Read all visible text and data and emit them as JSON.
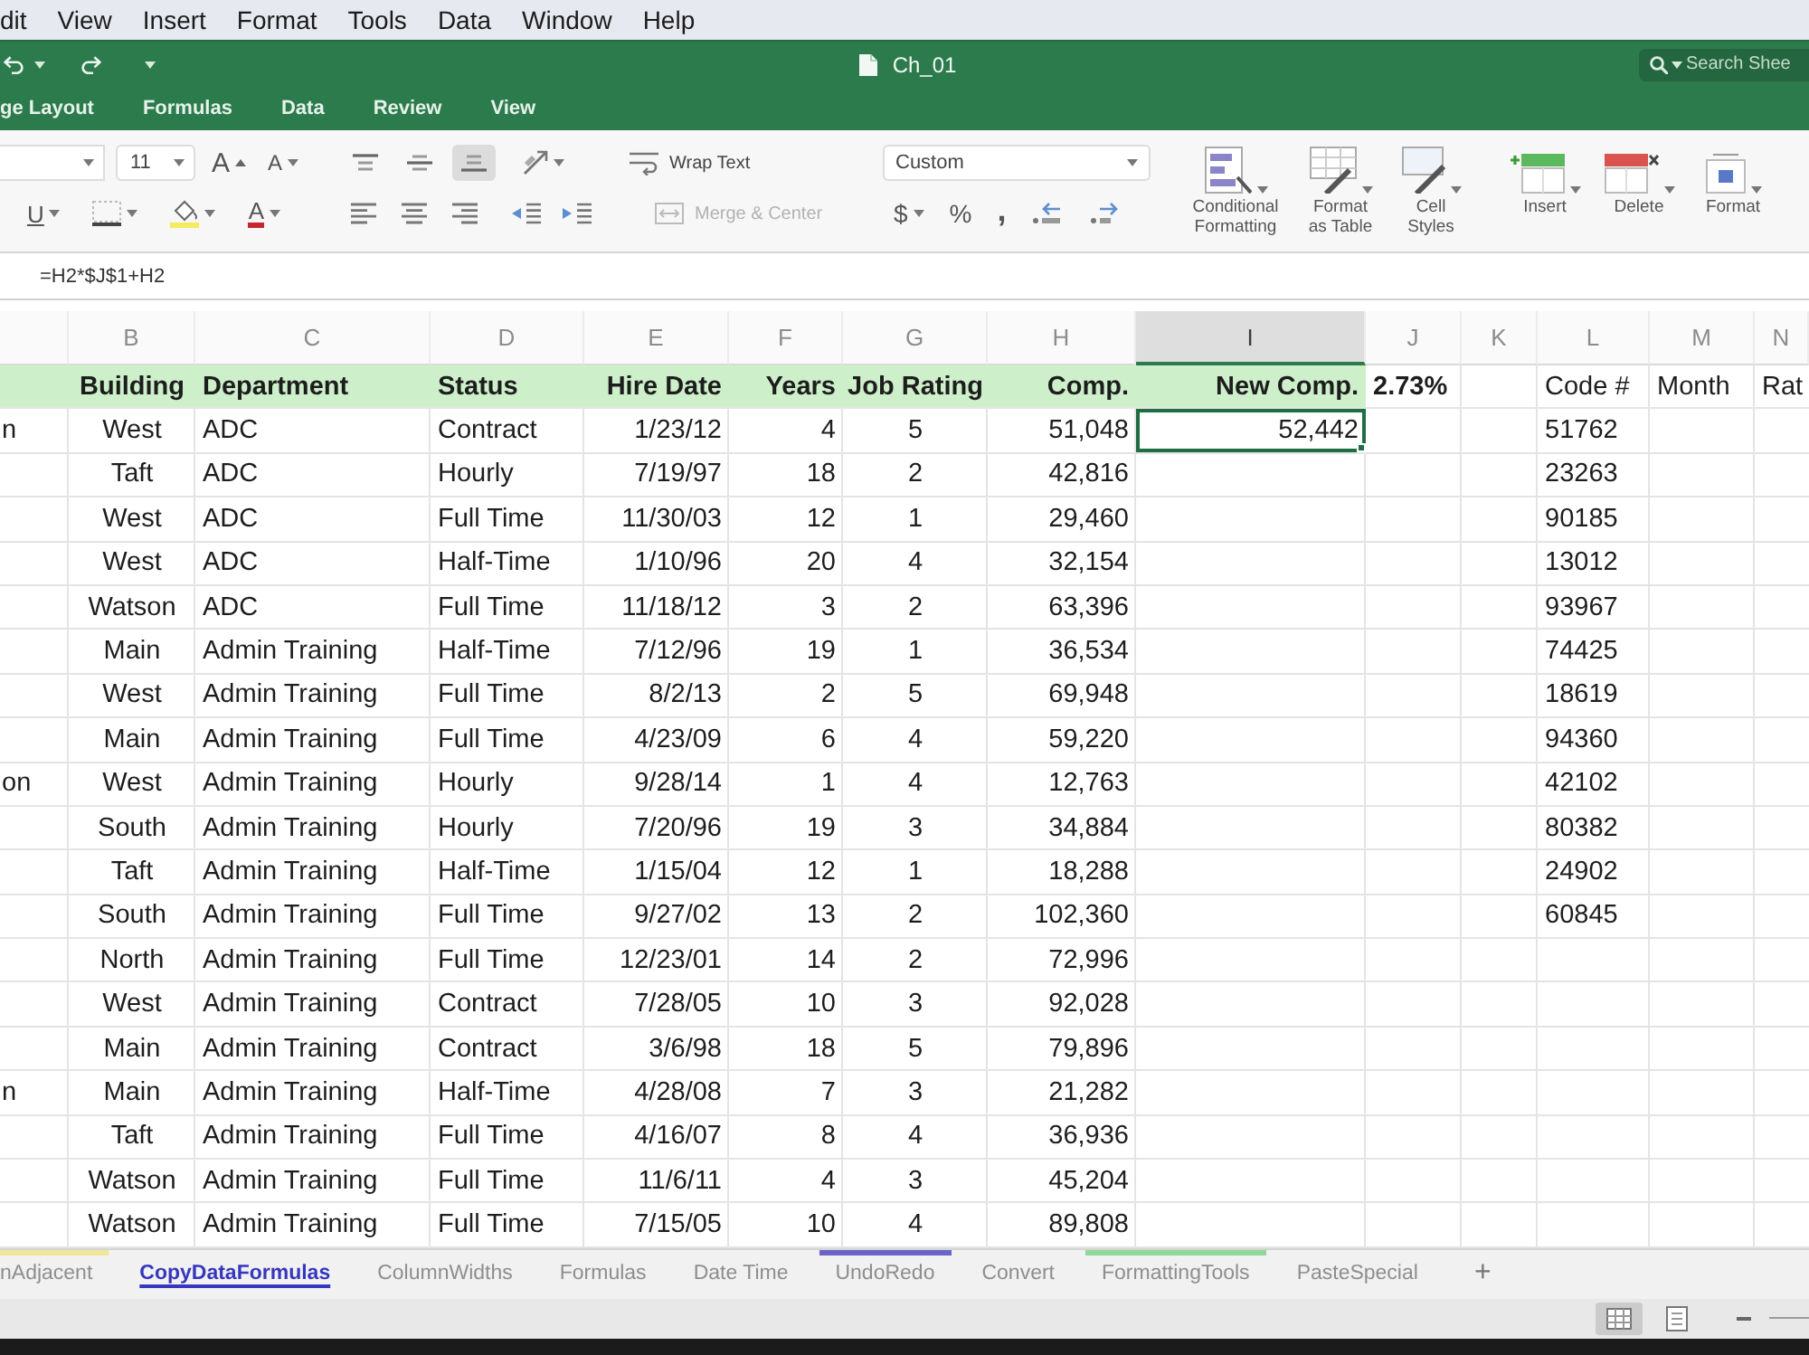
{
  "menu_bar": [
    "dit",
    "View",
    "Insert",
    "Format",
    "Tools",
    "Data",
    "Window",
    "Help"
  ],
  "title_bar": {
    "title": "Ch_01",
    "search": {
      "placeholder": "Search Shee"
    }
  },
  "ribbon_tabs": [
    {
      "label": "ge Layout",
      "selected": false
    },
    {
      "label": "Formulas",
      "selected": false
    },
    {
      "label": "Data",
      "selected": false
    },
    {
      "label": "Review",
      "selected": false
    },
    {
      "label": "View",
      "selected": false
    }
  ],
  "ribbon": {
    "font_size": "11",
    "font_buttons": [
      {
        "glyph": "A",
        "kind": "grow"
      },
      {
        "glyph": "A",
        "kind": "shrink"
      }
    ],
    "underline": "U",
    "font_color": "A",
    "vertical_align": [
      {
        "kind": "top",
        "selected": false
      },
      {
        "kind": "middle",
        "selected": false
      },
      {
        "kind": "bottom",
        "selected": true
      }
    ],
    "wrap_text": "Wrap Text",
    "merge_center": {
      "label": "Merge & Center",
      "disabled": true
    },
    "number_format": "Custom",
    "number_buttons": [
      {
        "glyph": "$",
        "kind": "currency"
      },
      {
        "glyph": "%",
        "kind": "percent"
      },
      {
        "glyph": ",",
        "kind": "comma"
      }
    ],
    "big_buttons": [
      {
        "label": "Conditional Formatting",
        "kind": "conditional"
      },
      {
        "label": "Format as Table",
        "kind": "table"
      },
      {
        "label": "Cell Styles",
        "kind": "styles"
      },
      {
        "label": "Insert",
        "kind": "insert"
      },
      {
        "label": "Delete",
        "kind": "delete"
      },
      {
        "label": "Format",
        "kind": "format"
      }
    ]
  },
  "formula_bar": {
    "formula": "=H2*$J$1+H2"
  },
  "sheet": {
    "columns": [
      {
        "selected": false
      },
      {
        "label": "B",
        "selected": false
      },
      {
        "label": "C",
        "selected": false
      },
      {
        "label": "D",
        "selected": false
      },
      {
        "label": "E",
        "selected": false
      },
      {
        "label": "F",
        "selected": false
      },
      {
        "label": "G",
        "selected": false
      },
      {
        "label": "H",
        "selected": false
      },
      {
        "label": "I",
        "selected": true
      },
      {
        "label": "J",
        "selected": false
      },
      {
        "label": "K",
        "selected": false
      },
      {
        "label": "L",
        "selected": false
      },
      {
        "label": "M",
        "selected": false
      },
      {
        "label": "N",
        "selected": false
      }
    ],
    "rows": [
      {
        "kind": "header",
        "selected": false,
        "cells": [
          {
            "kind": "table_header"
          },
          {
            "text": "Building",
            "kind": "table_header"
          },
          {
            "text": "Department",
            "kind": "table_header"
          },
          {
            "text": "Status",
            "kind": "table_header"
          },
          {
            "text": "Hire Date",
            "kind": "table_header"
          },
          {
            "text": "Years",
            "kind": "table_header"
          },
          {
            "text": "Job Rating",
            "kind": "table_header"
          },
          {
            "text": "Comp.",
            "kind": "table_header"
          },
          {
            "text": "New Comp.",
            "kind": "table_header"
          },
          {
            "text": "2.73%",
            "kind": "bold"
          },
          null,
          {
            "text": "Code #",
            "kind": "plain"
          },
          {
            "text": "Month",
            "kind": "plain"
          },
          {
            "text": "Rat",
            "kind": "plain"
          }
        ]
      },
      {
        "kind": "data",
        "selected": true,
        "cells": [
          "n",
          "West",
          "ADC",
          "Contract",
          "1/23/12",
          "4",
          "5",
          "51,048",
          "52,442",
          null,
          null,
          "51762"
        ]
      },
      {
        "kind": "data",
        "selected": false,
        "cells": [
          null,
          "Taft",
          "ADC",
          "Hourly",
          "7/19/97",
          "18",
          "2",
          "42,816",
          null,
          null,
          null,
          "23263"
        ]
      },
      {
        "kind": "data",
        "selected": false,
        "cells": [
          null,
          "West",
          "ADC",
          "Full Time",
          "11/30/03",
          "12",
          "1",
          "29,460",
          null,
          null,
          null,
          "90185"
        ]
      },
      {
        "kind": "data",
        "selected": false,
        "cells": [
          null,
          "West",
          "ADC",
          "Half-Time",
          "1/10/96",
          "20",
          "4",
          "32,154",
          null,
          null,
          null,
          "13012"
        ]
      },
      {
        "kind": "data",
        "selected": false,
        "cells": [
          null,
          "Watson",
          "ADC",
          "Full Time",
          "11/18/12",
          "3",
          "2",
          "63,396",
          null,
          null,
          null,
          "93967"
        ]
      },
      {
        "kind": "data",
        "selected": false,
        "cells": [
          null,
          "Main",
          "Admin Training",
          "Half-Time",
          "7/12/96",
          "19",
          "1",
          "36,534",
          null,
          null,
          null,
          "74425"
        ]
      },
      {
        "kind": "data",
        "selected": false,
        "cells": [
          null,
          "West",
          "Admin Training",
          "Full Time",
          "8/2/13",
          "2",
          "5",
          "69,948",
          null,
          null,
          null,
          "18619"
        ]
      },
      {
        "kind": "data",
        "selected": false,
        "cells": [
          null,
          "Main",
          "Admin Training",
          "Full Time",
          "4/23/09",
          "6",
          "4",
          "59,220",
          null,
          null,
          null,
          "94360"
        ]
      },
      {
        "kind": "data",
        "selected": false,
        "cells": [
          "on",
          "West",
          "Admin Training",
          "Hourly",
          "9/28/14",
          "1",
          "4",
          "12,763",
          null,
          null,
          null,
          "42102"
        ]
      },
      {
        "kind": "data",
        "selected": false,
        "cells": [
          null,
          "South",
          "Admin Training",
          "Hourly",
          "7/20/96",
          "19",
          "3",
          "34,884",
          null,
          null,
          null,
          "80382"
        ]
      },
      {
        "kind": "data",
        "selected": false,
        "cells": [
          null,
          "Taft",
          "Admin Training",
          "Half-Time",
          "1/15/04",
          "12",
          "1",
          "18,288",
          null,
          null,
          null,
          "24902"
        ]
      },
      {
        "kind": "data",
        "selected": false,
        "cells": [
          null,
          "South",
          "Admin Training",
          "Full Time",
          "9/27/02",
          "13",
          "2",
          "102,360",
          null,
          null,
          null,
          "60845"
        ]
      },
      {
        "kind": "data",
        "selected": false,
        "cells": [
          null,
          "North",
          "Admin Training",
          "Full Time",
          "12/23/01",
          "14",
          "2",
          "72,996"
        ]
      },
      {
        "kind": "data",
        "selected": false,
        "cells": [
          null,
          "West",
          "Admin Training",
          "Contract",
          "7/28/05",
          "10",
          "3",
          "92,028"
        ]
      },
      {
        "kind": "data",
        "selected": false,
        "cells": [
          null,
          "Main",
          "Admin Training",
          "Contract",
          "3/6/98",
          "18",
          "5",
          "79,896"
        ]
      },
      {
        "kind": "data",
        "selected": false,
        "cells": [
          "n",
          "Main",
          "Admin Training",
          "Half-Time",
          "4/28/08",
          "7",
          "3",
          "21,282"
        ]
      },
      {
        "kind": "data",
        "selected": false,
        "cells": [
          null,
          "Taft",
          "Admin Training",
          "Full Time",
          "4/16/07",
          "8",
          "4",
          "36,936"
        ]
      },
      {
        "kind": "data",
        "selected": false,
        "cells": [
          null,
          "Watson",
          "Admin Training",
          "Full Time",
          "11/6/11",
          "4",
          "3",
          "45,204"
        ]
      },
      {
        "kind": "data",
        "selected": false,
        "cells": [
          null,
          "Watson",
          "Admin Training",
          "Full Time",
          "7/15/05",
          "10",
          "4",
          "89,808"
        ]
      }
    ]
  },
  "sheet_tabs": {
    "tabs": [
      {
        "label": "nAdjacent",
        "selected": false,
        "color": "#eee79a"
      },
      {
        "label": "CopyDataFormulas",
        "selected": true
      },
      {
        "label": "ColumnWidths",
        "selected": false
      },
      {
        "label": "Formulas",
        "selected": false
      },
      {
        "label": "Date Time",
        "selected": false
      },
      {
        "label": "UndoRedo",
        "selected": false,
        "color": "#6a64c8"
      },
      {
        "label": "Convert",
        "selected": false
      },
      {
        "label": "FormattingTools",
        "selected": false,
        "color": "#8fd89a"
      },
      {
        "label": "PasteSpecial",
        "selected": false
      }
    ],
    "add": "+"
  },
  "status_bar": {
    "views": [
      {
        "kind": "normal",
        "selected": true
      },
      {
        "kind": "page_layout",
        "selected": false
      }
    ]
  }
}
